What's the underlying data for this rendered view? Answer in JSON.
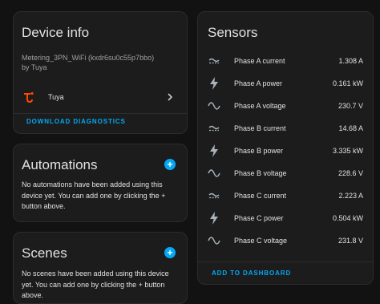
{
  "device_info": {
    "title": "Device info",
    "model": "Metering_3PN_WiFi (kxdr6su0c55p7bbo)",
    "manufacturer": "by Tuya",
    "integration": "Tuya",
    "download_label": "DOWNLOAD DIAGNOSTICS"
  },
  "automations": {
    "title": "Automations",
    "text": "No automations have been added using this device yet. You can add one by clicking the + button above."
  },
  "scenes": {
    "title": "Scenes",
    "text": "No scenes have been added using this device yet. You can add one by clicking the + button above."
  },
  "sensors": {
    "title": "Sensors",
    "add_label": "ADD TO DASHBOARD",
    "items": [
      {
        "label": "Phase A current",
        "value": "1.308 A",
        "icon": "current-ac-icon"
      },
      {
        "label": "Phase A power",
        "value": "0.161 kW",
        "icon": "flash-icon"
      },
      {
        "label": "Phase A voltage",
        "value": "230.7 V",
        "icon": "sine-wave-icon"
      },
      {
        "label": "Phase B current",
        "value": "14.68 A",
        "icon": "current-ac-icon"
      },
      {
        "label": "Phase B power",
        "value": "3.335 kW",
        "icon": "flash-icon"
      },
      {
        "label": "Phase B voltage",
        "value": "228.6 V",
        "icon": "sine-wave-icon"
      },
      {
        "label": "Phase C current",
        "value": "2.223 A",
        "icon": "current-ac-icon"
      },
      {
        "label": "Phase C power",
        "value": "0.504 kW",
        "icon": "flash-icon"
      },
      {
        "label": "Phase C voltage",
        "value": "231.8 V",
        "icon": "sine-wave-icon"
      }
    ]
  },
  "colors": {
    "accent": "#03a9f4",
    "tuya": "#ff4800",
    "icon": "#a9b4bd"
  }
}
